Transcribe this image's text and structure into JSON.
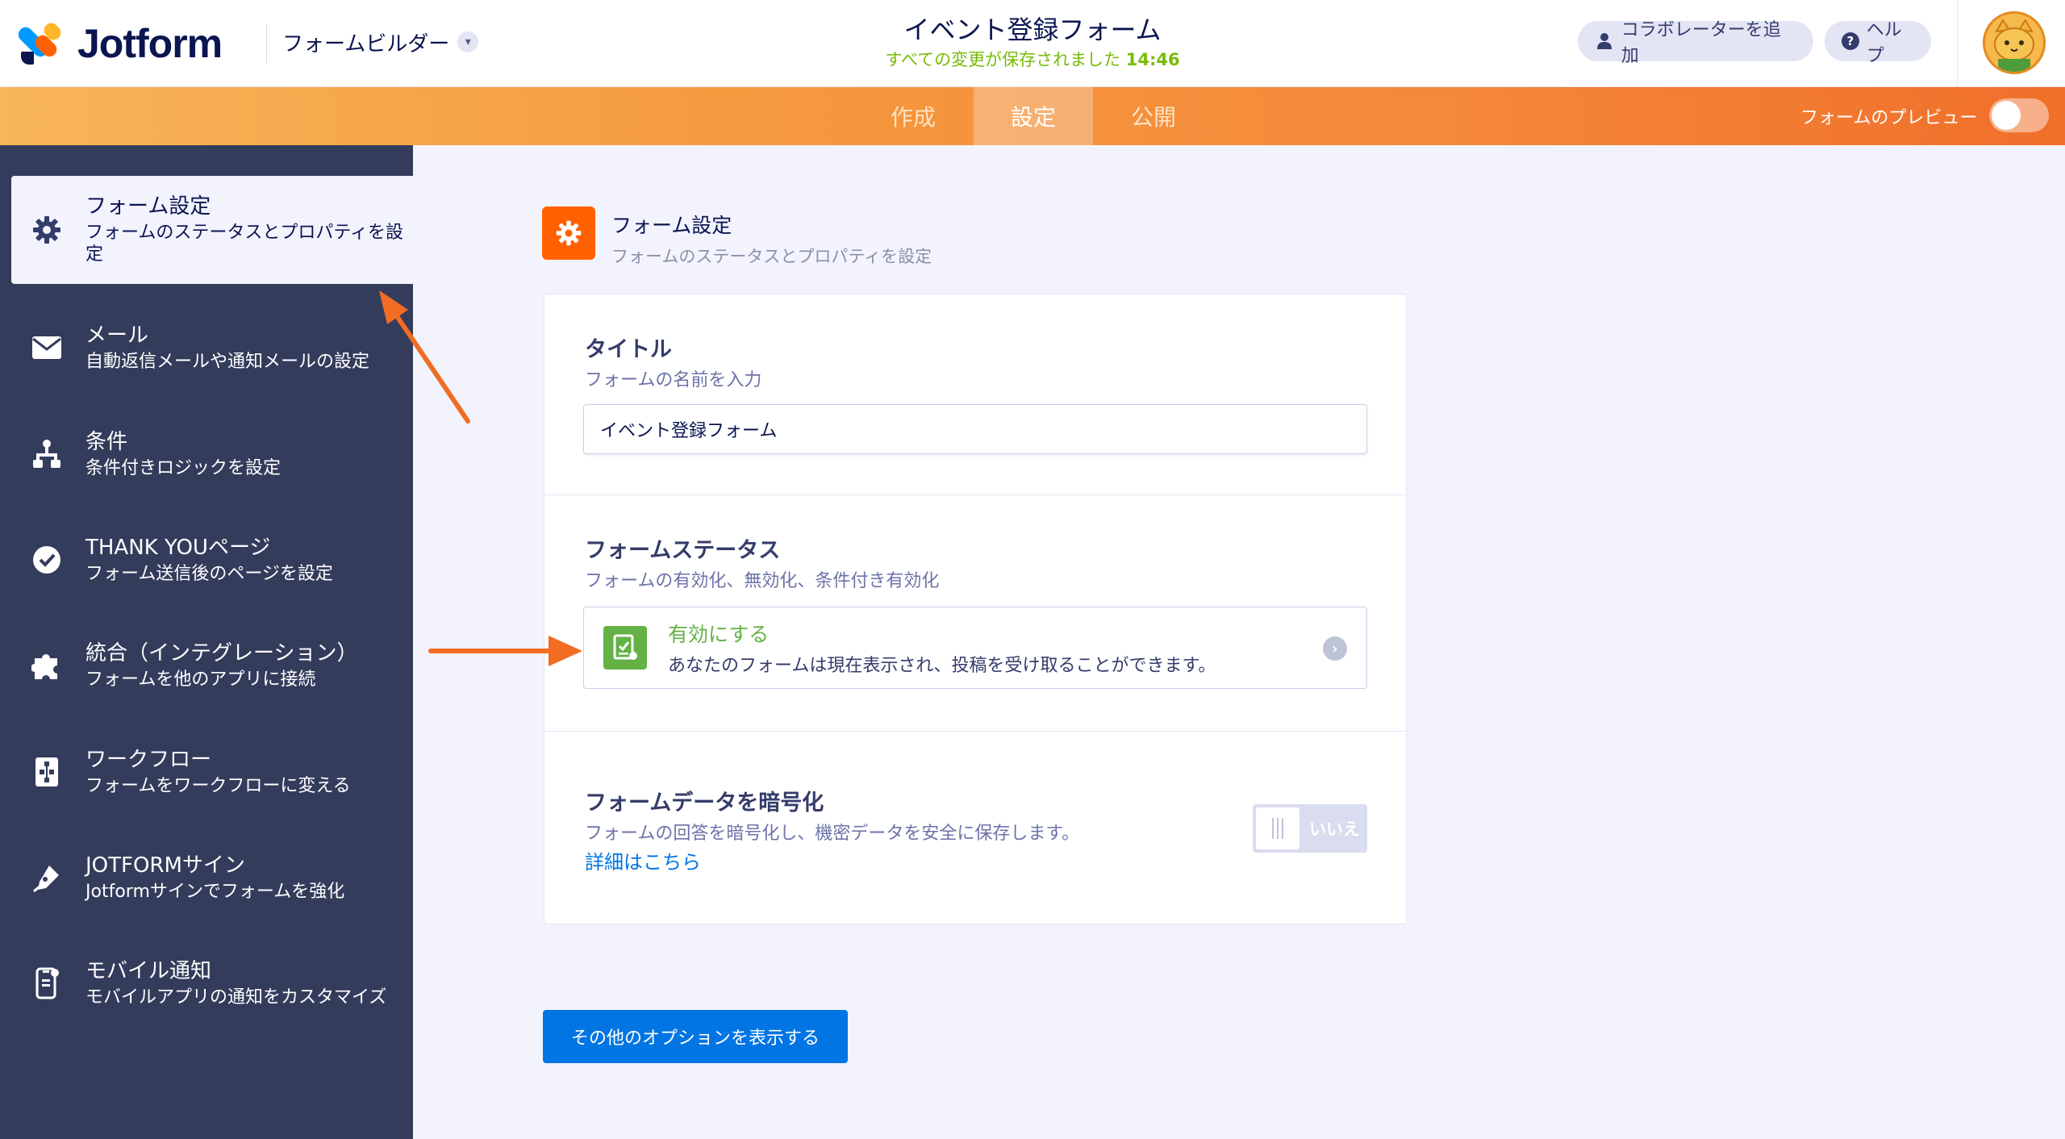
{
  "header": {
    "brand": "Jotform",
    "builder_menu": "フォームビルダー",
    "form_title": "イベント登録フォーム",
    "save_status": "すべての変更が保存されました",
    "save_time": "14:46",
    "add_collaborator": "コラボレーターを追加",
    "help": "ヘルプ"
  },
  "nav": {
    "tabs": [
      {
        "label": "作成",
        "active": false
      },
      {
        "label": "設定",
        "active": true
      },
      {
        "label": "公開",
        "active": false
      }
    ],
    "preview_label": "フォームのプレビュー",
    "preview_on": false
  },
  "sidebar": {
    "items": [
      {
        "title": "フォーム設定",
        "subtitle": "フォームのステータスとプロパティを設定",
        "icon": "gear-icon",
        "active": true
      },
      {
        "title": "メール",
        "subtitle": "自動返信メールや通知メールの設定",
        "icon": "envelope-icon",
        "active": false
      },
      {
        "title": "条件",
        "subtitle": "条件付きロジックを設定",
        "icon": "hierarchy-icon",
        "active": false
      },
      {
        "title": "THANK YOUページ",
        "subtitle": "フォーム送信後のページを設定",
        "icon": "check-circle-icon",
        "active": false
      },
      {
        "title": "統合（インテグレーション）",
        "subtitle": "フォームを他のアプリに接続",
        "icon": "puzzle-icon",
        "active": false
      },
      {
        "title": "ワークフロー",
        "subtitle": "フォームをワークフローに変える",
        "icon": "workflow-icon",
        "active": false
      },
      {
        "title": "JOTFORMサイン",
        "subtitle": "Jotformサインでフォームを強化",
        "icon": "pen-icon",
        "active": false
      },
      {
        "title": "モバイル通知",
        "subtitle": "モバイルアプリの通知をカスタマイズ",
        "icon": "mobile-icon",
        "active": false
      }
    ]
  },
  "main": {
    "heading": "フォーム設定",
    "subheading": "フォームのステータスとプロパティを設定",
    "title_section": {
      "label": "タイトル",
      "description": "フォームの名前を入力",
      "value": "イベント登録フォーム"
    },
    "status_section": {
      "label": "フォームステータス",
      "description": "フォームの有効化、無効化、条件付き有効化",
      "status_title": "有効にする",
      "status_desc": "あなたのフォームは現在表示され、投稿を受け取ることができます。"
    },
    "encrypt_section": {
      "label": "フォームデータを暗号化",
      "description": "フォームの回答を暗号化し、機密データを安全に保存します。",
      "link": "詳細はこちら",
      "toggle_label": "いいえ",
      "enabled": false
    },
    "more_options": "その他のオプションを表示する"
  },
  "colors": {
    "brand_orange": "#ff6100",
    "sidebar_bg": "#343c5c",
    "active_green": "#64b245",
    "link_blue": "#0075e3",
    "annotation_arrow": "#f26c23"
  }
}
